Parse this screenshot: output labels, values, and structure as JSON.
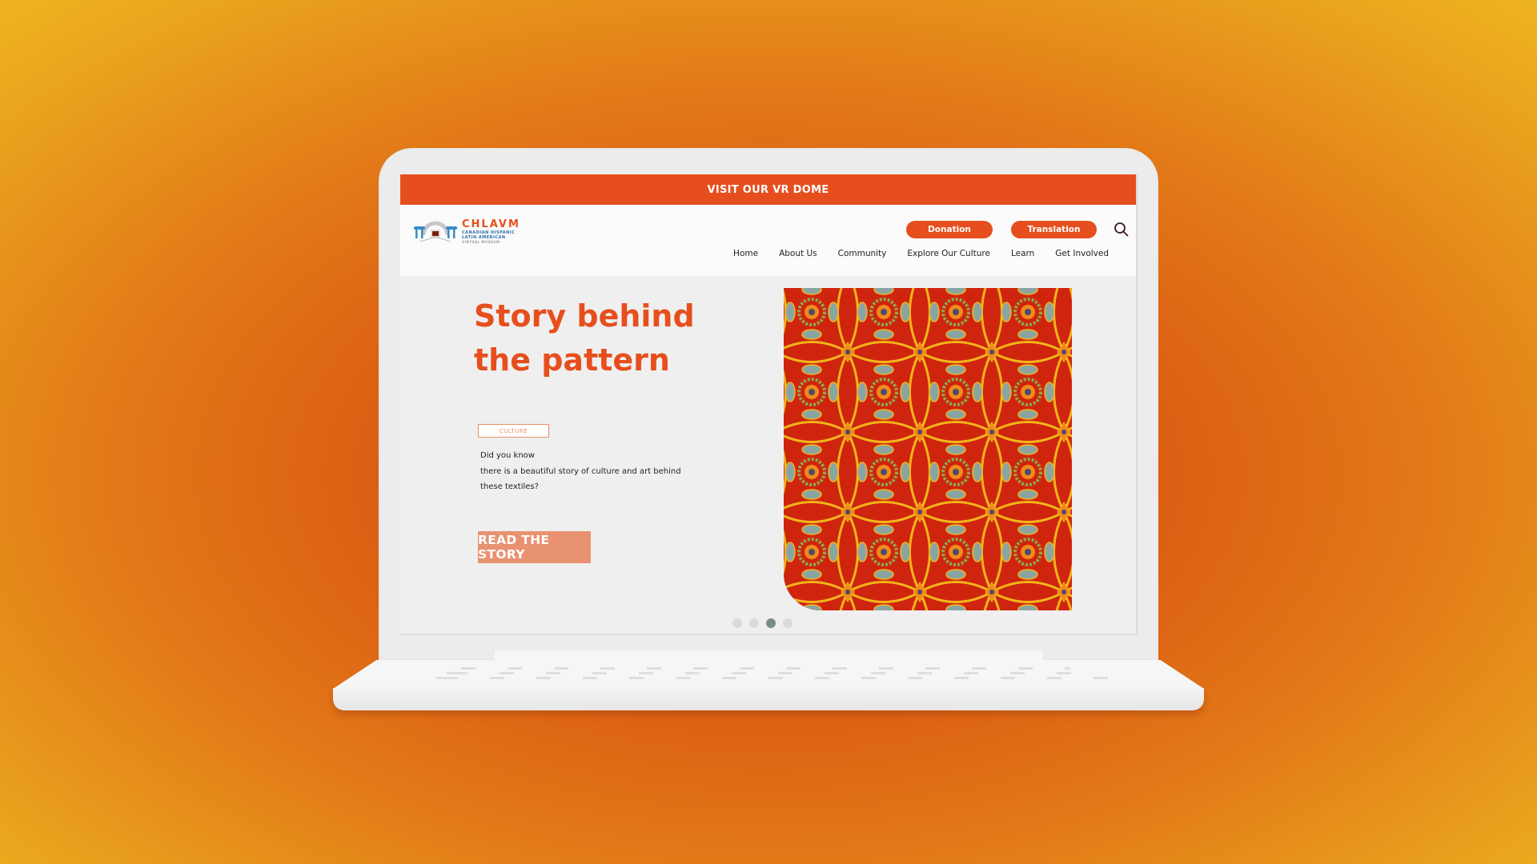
{
  "banner": {
    "text": "VISIT OUR VR DOME"
  },
  "logo": {
    "name": "CHLAVM",
    "line1": "CANADIAN HISPANIC",
    "line2": "LATIN AMERICAN",
    "line3": "VIRTUAL MUSEUM"
  },
  "header": {
    "donation_label": "Donation",
    "translation_label": "Translation",
    "search_icon": "search-icon"
  },
  "nav": {
    "items": [
      {
        "label": "Home"
      },
      {
        "label": "About Us"
      },
      {
        "label": "Community"
      },
      {
        "label": "Explore Our Culture"
      },
      {
        "label": "Learn"
      },
      {
        "label": "Get Involved"
      }
    ]
  },
  "hero": {
    "title_line1": "Story behind",
    "title_line2": "the pattern",
    "tag": "CULTURE",
    "body_line1": "Did you know",
    "body_line2": "there is a beautiful story of culture and art behind",
    "body_line3": "these textiles?",
    "cta_label": "READ THE STORY",
    "image_alt": "textile-pattern"
  },
  "carousel": {
    "count": 4,
    "active_index": 2
  },
  "colors": {
    "brand_orange": "#e64f1d",
    "cta_salmon": "#e99272",
    "pattern_red": "#cf250e",
    "pattern_yellow": "#f3b51c",
    "pattern_green": "#8fa94a",
    "pattern_blue": "#8aa5a0",
    "dot_active": "#7b8b89"
  }
}
